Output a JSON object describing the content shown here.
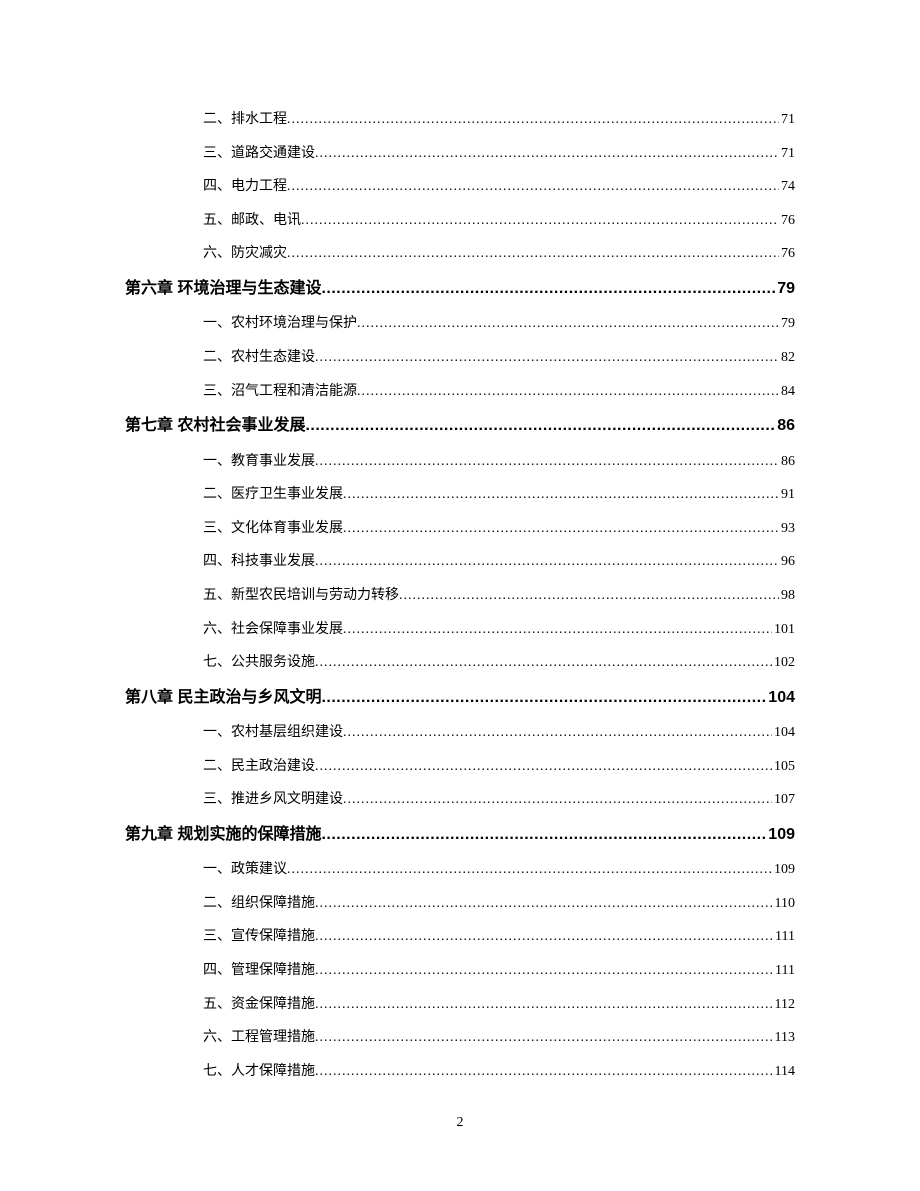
{
  "toc": [
    {
      "level": "sub",
      "label": "二、排水工程",
      "page": "71"
    },
    {
      "level": "sub",
      "label": "三、道路交通建设",
      "page": "71"
    },
    {
      "level": "sub",
      "label": "四、电力工程",
      "page": "74"
    },
    {
      "level": "sub",
      "label": "五、邮政、电讯",
      "page": "76"
    },
    {
      "level": "sub",
      "label": "六、防灾减灾",
      "page": "76"
    },
    {
      "level": "chapter",
      "label": "第六章  环境治理与生态建设",
      "page": "79"
    },
    {
      "level": "sub",
      "label": "一、农村环境治理与保护",
      "page": "79"
    },
    {
      "level": "sub",
      "label": "二、农村生态建设",
      "page": "82"
    },
    {
      "level": "sub",
      "label": "三、沼气工程和清洁能源",
      "page": "84"
    },
    {
      "level": "chapter",
      "label": "第七章  农村社会事业发展",
      "page": "86"
    },
    {
      "level": "sub",
      "label": "一、教育事业发展",
      "page": "86"
    },
    {
      "level": "sub",
      "label": "二、医疗卫生事业发展",
      "page": "91"
    },
    {
      "level": "sub",
      "label": "三、文化体育事业发展",
      "page": "93"
    },
    {
      "level": "sub",
      "label": "四、科技事业发展",
      "page": "96"
    },
    {
      "level": "sub",
      "label": "五、新型农民培训与劳动力转移",
      "page": "98"
    },
    {
      "level": "sub",
      "label": "六、社会保障事业发展",
      "page": "101"
    },
    {
      "level": "sub",
      "label": "七、公共服务设施",
      "page": "102"
    },
    {
      "level": "chapter",
      "label": "第八章    民主政治与乡风文明",
      "page": "104"
    },
    {
      "level": "sub",
      "label": "一、农村基层组织建设",
      "page": "104"
    },
    {
      "level": "sub",
      "label": "二、民主政治建设",
      "page": "105"
    },
    {
      "level": "sub",
      "label": "三、推进乡风文明建设",
      "page": "107"
    },
    {
      "level": "chapter",
      "label": "第九章    规划实施的保障措施",
      "page": "109"
    },
    {
      "level": "sub",
      "label": "一、政策建议",
      "page": "109"
    },
    {
      "level": "sub",
      "label": "二、组织保障措施",
      "page": "110"
    },
    {
      "level": "sub",
      "label": "三、宣传保障措施",
      "page": "111"
    },
    {
      "level": "sub",
      "label": "四、管理保障措施",
      "page": "111"
    },
    {
      "level": "sub",
      "label": "五、资金保障措施",
      "page": "112"
    },
    {
      "level": "sub",
      "label": "六、工程管理措施",
      "page": "113"
    },
    {
      "level": "sub",
      "label": "七、人才保障措施",
      "page": "114"
    }
  ],
  "page_number": "2"
}
